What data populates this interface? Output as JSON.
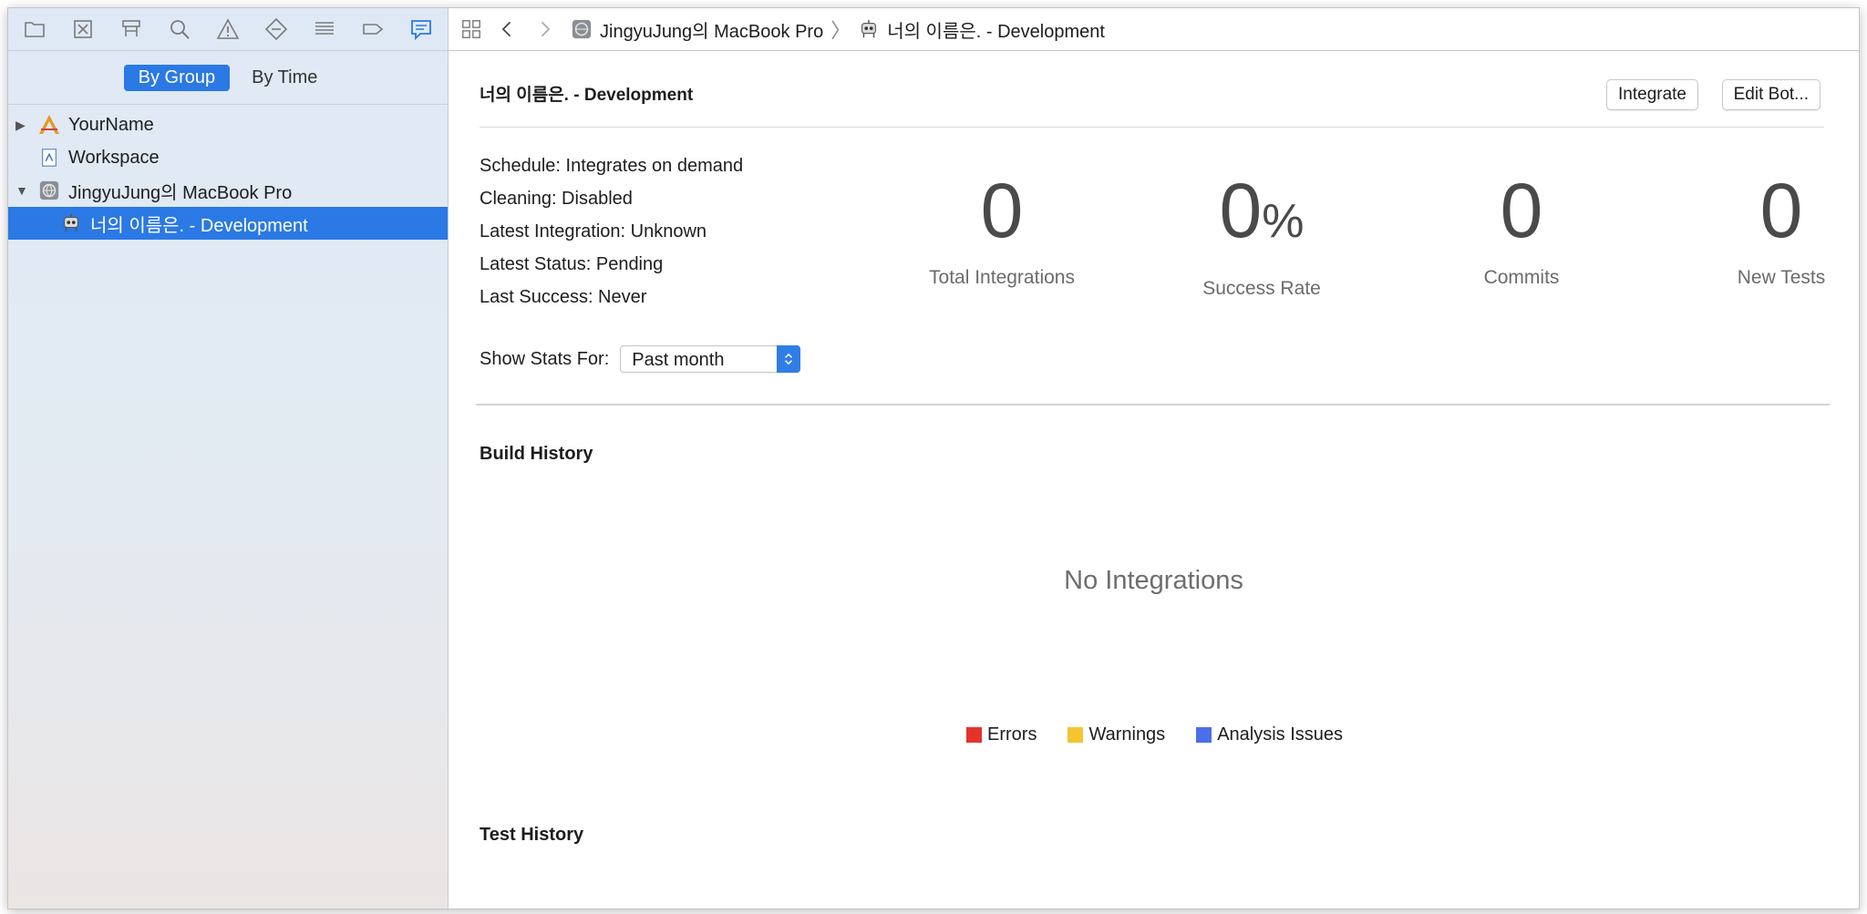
{
  "sidebar": {
    "segments": [
      "By Group",
      "By Time"
    ],
    "tree": [
      {
        "label": "YourName"
      },
      {
        "label": "Workspace"
      },
      {
        "label": "JingyuJung의 MacBook Pro"
      },
      {
        "label": "너의 이름은. - Development"
      }
    ]
  },
  "jumpbar": {
    "crumbs": [
      "JingyuJung의 MacBook Pro",
      "너의 이름은. - Development"
    ]
  },
  "bot": {
    "title": "너의 이름은. - Development",
    "integrate_label": "Integrate",
    "edit_label": "Edit Bot...",
    "info": [
      "Schedule: Integrates on demand",
      "Cleaning: Disabled",
      "Latest Integration: Unknown",
      "Latest Status: Pending",
      "Last Success: Never"
    ],
    "stats": [
      {
        "value": "0",
        "label": "Total Integrations"
      },
      {
        "value": "0",
        "suffix": "%",
        "label": "Success Rate"
      },
      {
        "value": "0",
        "label": "Commits"
      },
      {
        "value": "0",
        "label": "New Tests"
      }
    ],
    "stats_for_label": "Show Stats For:",
    "stats_for_value": "Past month"
  },
  "build_history": {
    "title": "Build History",
    "empty_text": "No Integrations",
    "legend": [
      {
        "label": "Errors",
        "color": "#e5322d"
      },
      {
        "label": "Warnings",
        "color": "#f5c531"
      },
      {
        "label": "Analysis Issues",
        "color": "#4a6fe8"
      }
    ]
  },
  "test_history": {
    "title": "Test History"
  },
  "colors": {
    "accent": "#2a79e4"
  }
}
